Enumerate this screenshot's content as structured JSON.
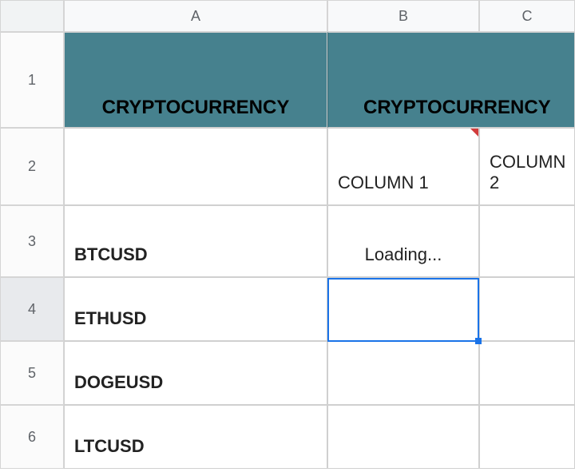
{
  "columns": {
    "A": "A",
    "B": "B",
    "C": "C"
  },
  "rows": {
    "r1": "1",
    "r2": "2",
    "r3": "3",
    "r4": "4",
    "r5": "5",
    "r6": "6"
  },
  "header": {
    "A": "CRYPTOCURRENCY",
    "BC": "CRYPTOCURRENCY"
  },
  "subheader": {
    "B": "COLUMN 1",
    "C": "COLUMN 2"
  },
  "data": {
    "A3": "BTCUSD",
    "A4": "ETHUSD",
    "A5": "DOGEUSD",
    "A6": "LTCUSD",
    "B3": "Loading..."
  },
  "selection": {
    "cell": "B4"
  }
}
